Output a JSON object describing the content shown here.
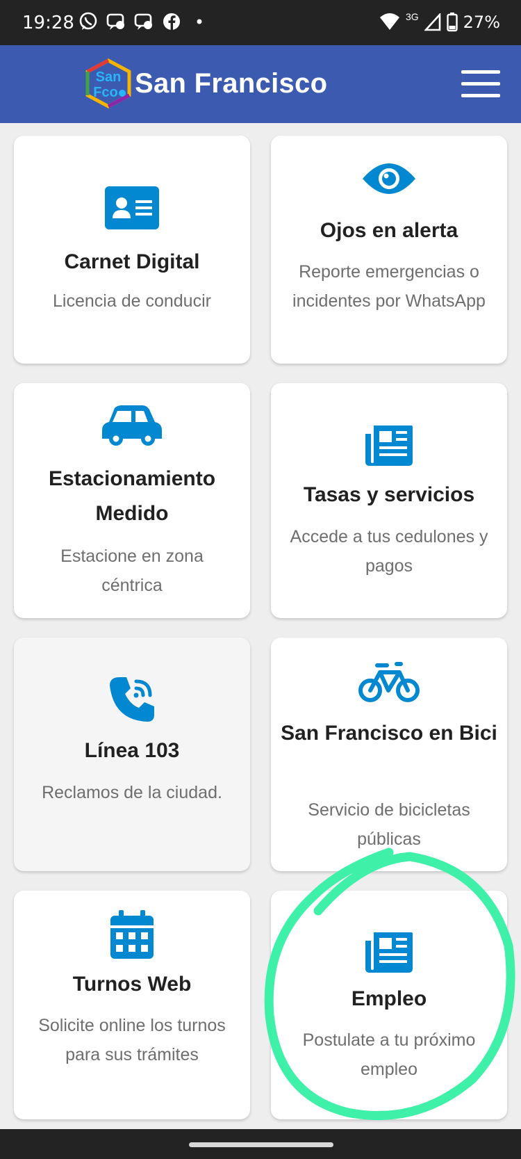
{
  "status_bar": {
    "time": "19:28",
    "network": "3G",
    "battery": "27%",
    "notification_icons": [
      "whatsapp-icon",
      "chat-bubble-icon",
      "chat-bubble-icon",
      "facebook-icon",
      "dot-icon"
    ]
  },
  "app_bar": {
    "title": "San Francisco",
    "logo_text": "San Fco",
    "background_color": "#3c5bb0"
  },
  "accent_color": "#0288d1",
  "highlight_color": "#3ff0a8",
  "cards": [
    {
      "title": "Carnet Digital",
      "desc": "Licencia de conducir",
      "icon": "id-card-icon"
    },
    {
      "title": "Ojos en alerta",
      "desc": "Reporte emergencias o incidentes por WhatsApp",
      "icon": "eye-icon"
    },
    {
      "title": "Estacionamiento Medido",
      "desc": "Estacione en zona céntrica",
      "icon": "car-icon"
    },
    {
      "title": "Tasas y servicios",
      "desc": "Accede a tus cedulones y pagos",
      "icon": "newspaper-icon"
    },
    {
      "title": "Línea 103",
      "desc": "Reclamos de la ciudad.",
      "icon": "phone-signal-icon"
    },
    {
      "title": "San Francisco en Bici",
      "desc": "Servicio de bicicletas públicas",
      "icon": "bicycle-icon"
    },
    {
      "title": "Turnos Web",
      "desc": "Solicite online los turnos para sus trámites",
      "icon": "calendar-icon"
    },
    {
      "title": "Empleo",
      "desc": "Postulate a tu próximo empleo",
      "icon": "newspaper-icon"
    }
  ]
}
